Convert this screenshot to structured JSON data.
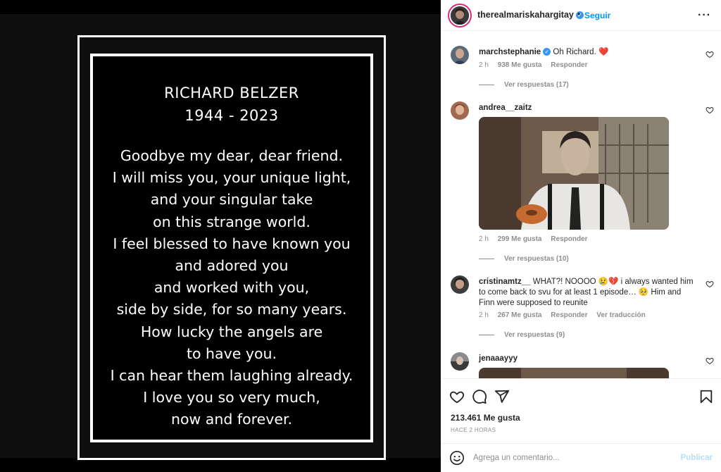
{
  "memorial": {
    "title_lines": [
      "RICHARD BELZER",
      "1944 - 2023"
    ],
    "poem_lines": [
      "Goodbye my dear, dear friend.",
      "I will miss you, your unique light,",
      "and your singular take",
      "on this strange world.",
      "I feel blessed to have known you",
      "and adored you",
      "and worked with you,",
      "side by side, for so many years.",
      "How lucky the angels are",
      "to have you.",
      "I can hear them laughing already.",
      "I love you so very much,",
      "now and forever."
    ]
  },
  "header": {
    "username": "therealmariskahargitay",
    "separator": "•",
    "follow_label": "Seguir",
    "more_icon": "more-horizontal-icon"
  },
  "comments": [
    {
      "username": "marchstephanie",
      "verified": true,
      "text": "Oh Richard. ❤️",
      "time": "2 h",
      "likes": "938 Me gusta",
      "reply_label": "Responder",
      "view_replies": "Ver respuestas (17)"
    },
    {
      "username": "andrea__zaitz",
      "text": "",
      "time": "2 h",
      "likes": "299 Me gusta",
      "reply_label": "Responder",
      "view_replies": "Ver respuestas (10)"
    },
    {
      "username": "cristinamtz__",
      "text": "WHAT?! NOOOO 😢💔 i always wanted him to come back to svu for at least 1 episode… 🥺 Him and Finn were supposed to reunite",
      "time": "2 h",
      "likes": "267 Me gusta",
      "reply_label": "Responder",
      "translate_label": "Ver traducción",
      "view_replies": "Ver respuestas (9)"
    },
    {
      "username": "jenaaayyy",
      "text": ""
    }
  ],
  "actions": {
    "likes": "213.461 Me gusta",
    "time_ago": "HACE 2 HORAS"
  },
  "add_comment": {
    "placeholder": "Agrega un comentario...",
    "publish_label": "Publicar"
  },
  "colors": {
    "link_blue": "#0095f6",
    "verified_blue": "#3897f0",
    "muted": "#8e8e8e",
    "heart_red": "#ed4956"
  }
}
